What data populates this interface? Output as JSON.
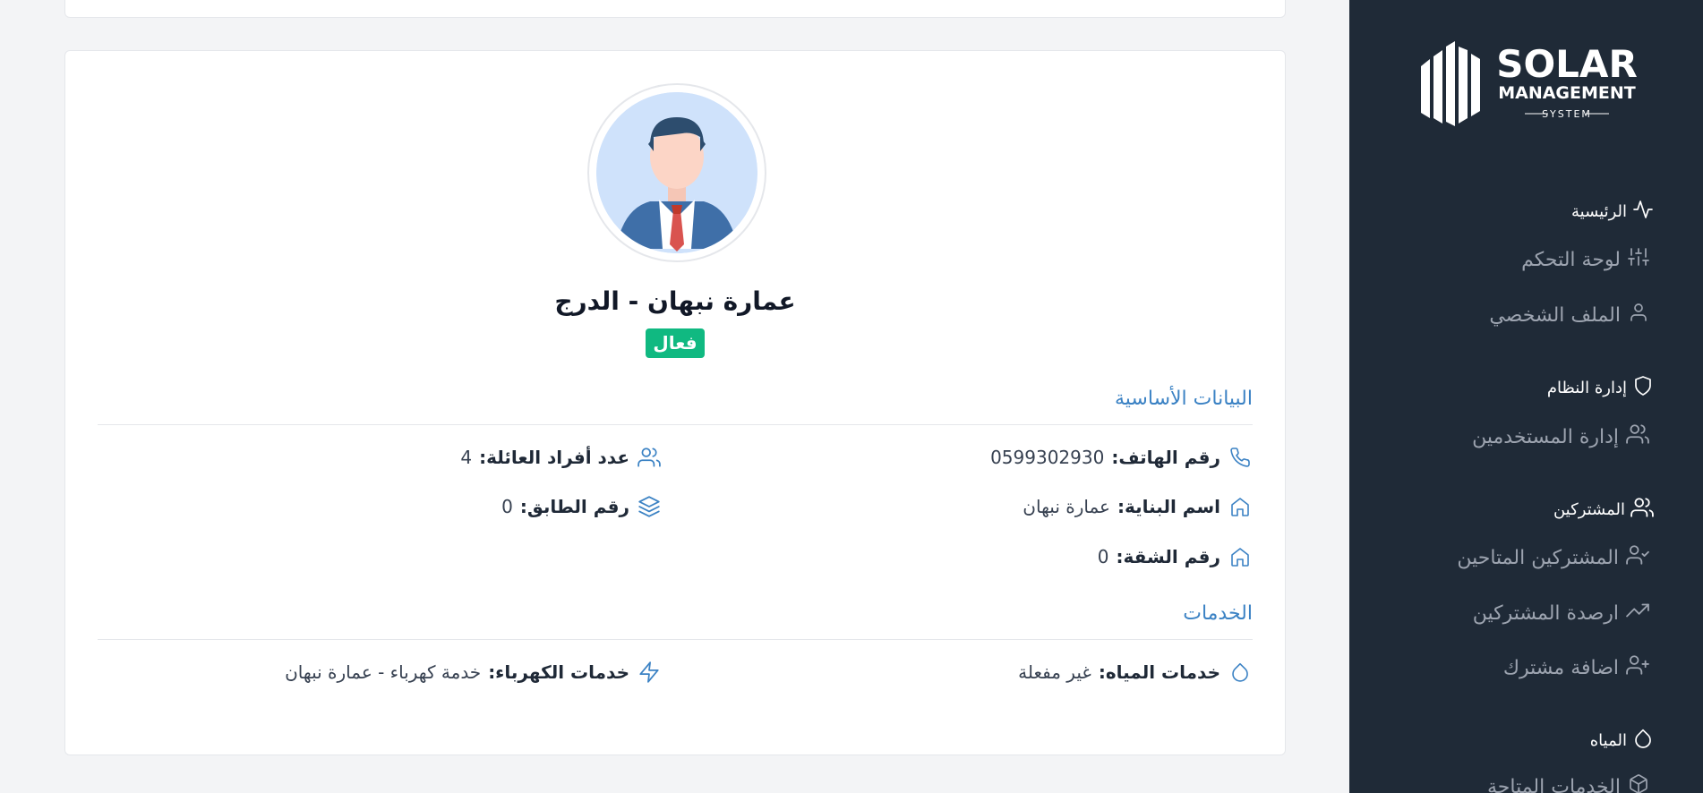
{
  "sidebar": {
    "logo": {
      "line1": "SOLAR",
      "line2": "MANAGEMENT",
      "line3": "SYSTEM"
    },
    "sections": [
      {
        "label": "الرئيسية",
        "icon": "activity-icon"
      },
      {
        "label": "إدارة النظام",
        "icon": "shield-icon"
      },
      {
        "label": "المشتركين",
        "icon": "users-icon"
      },
      {
        "label": "المياه",
        "icon": "droplet-icon"
      }
    ],
    "items": [
      {
        "label": "لوحة التحكم",
        "icon": "sliders-icon"
      },
      {
        "label": "الملف الشخصي",
        "icon": "user-icon"
      },
      {
        "label": "إدارة المستخدمين",
        "icon": "users-icon"
      },
      {
        "label": "المشتركين المتاحين",
        "icon": "user-check-icon"
      },
      {
        "label": "ارصدة المشتركين",
        "icon": "trending-up-icon"
      },
      {
        "label": "اضافة مشترك",
        "icon": "user-plus-icon"
      },
      {
        "label": "الخدمات المتاحة",
        "icon": "package-icon"
      }
    ]
  },
  "profile": {
    "name": "عمارة نبهان - الدرج",
    "status": "فعال"
  },
  "basic": {
    "title": "البيانات الأساسية",
    "phone_label": "رقم الهاتف:",
    "phone_value": "0599302930",
    "family_label": "عدد أفراد العائلة:",
    "family_value": "4",
    "building_label": "اسم البناية:",
    "building_value": "عمارة نبهان",
    "floor_label": "رقم الطابق:",
    "floor_value": "0",
    "apartment_label": "رقم الشقة:",
    "apartment_value": "0"
  },
  "services": {
    "title": "الخدمات",
    "water_label": "خدمات المياه:",
    "water_value": "غير مفعلة",
    "electric_label": "خدمات الكهرباء:",
    "electric_value": "خدمة كهرباء - عمارة نبهان"
  },
  "colors": {
    "sidebar_bg": "#1f2a37",
    "accent": "#3b82c4",
    "status_active": "#10b981"
  }
}
